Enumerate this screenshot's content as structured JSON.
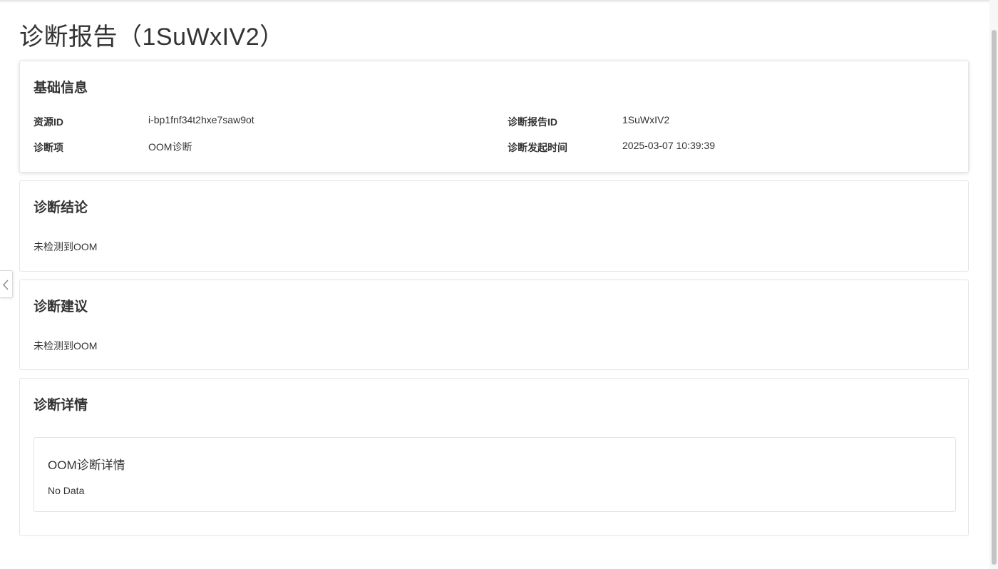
{
  "page": {
    "title": "诊断报告（1SuWxIV2）"
  },
  "basic_info": {
    "title": "基础信息",
    "fields": [
      {
        "label": "资源ID",
        "value": "i-bp1fnf34t2hxe7saw9ot"
      },
      {
        "label": "诊断报告ID",
        "value": "1SuWxIV2"
      },
      {
        "label": "诊断项",
        "value": "OOM诊断"
      },
      {
        "label": "诊断发起时间",
        "value": "2025-03-07 10:39:39"
      }
    ]
  },
  "conclusion": {
    "title": "诊断结论",
    "text": "未检测到OOM"
  },
  "suggestion": {
    "title": "诊断建议",
    "text": "未检测到OOM"
  },
  "details": {
    "title": "诊断详情",
    "item_title": "OOM诊断详情",
    "item_text": "No Data"
  },
  "icons": {
    "collapse": "chevron-left-icon"
  },
  "colors": {
    "text": "#333333",
    "border": "#e5e5e5",
    "background": "#ffffff"
  }
}
